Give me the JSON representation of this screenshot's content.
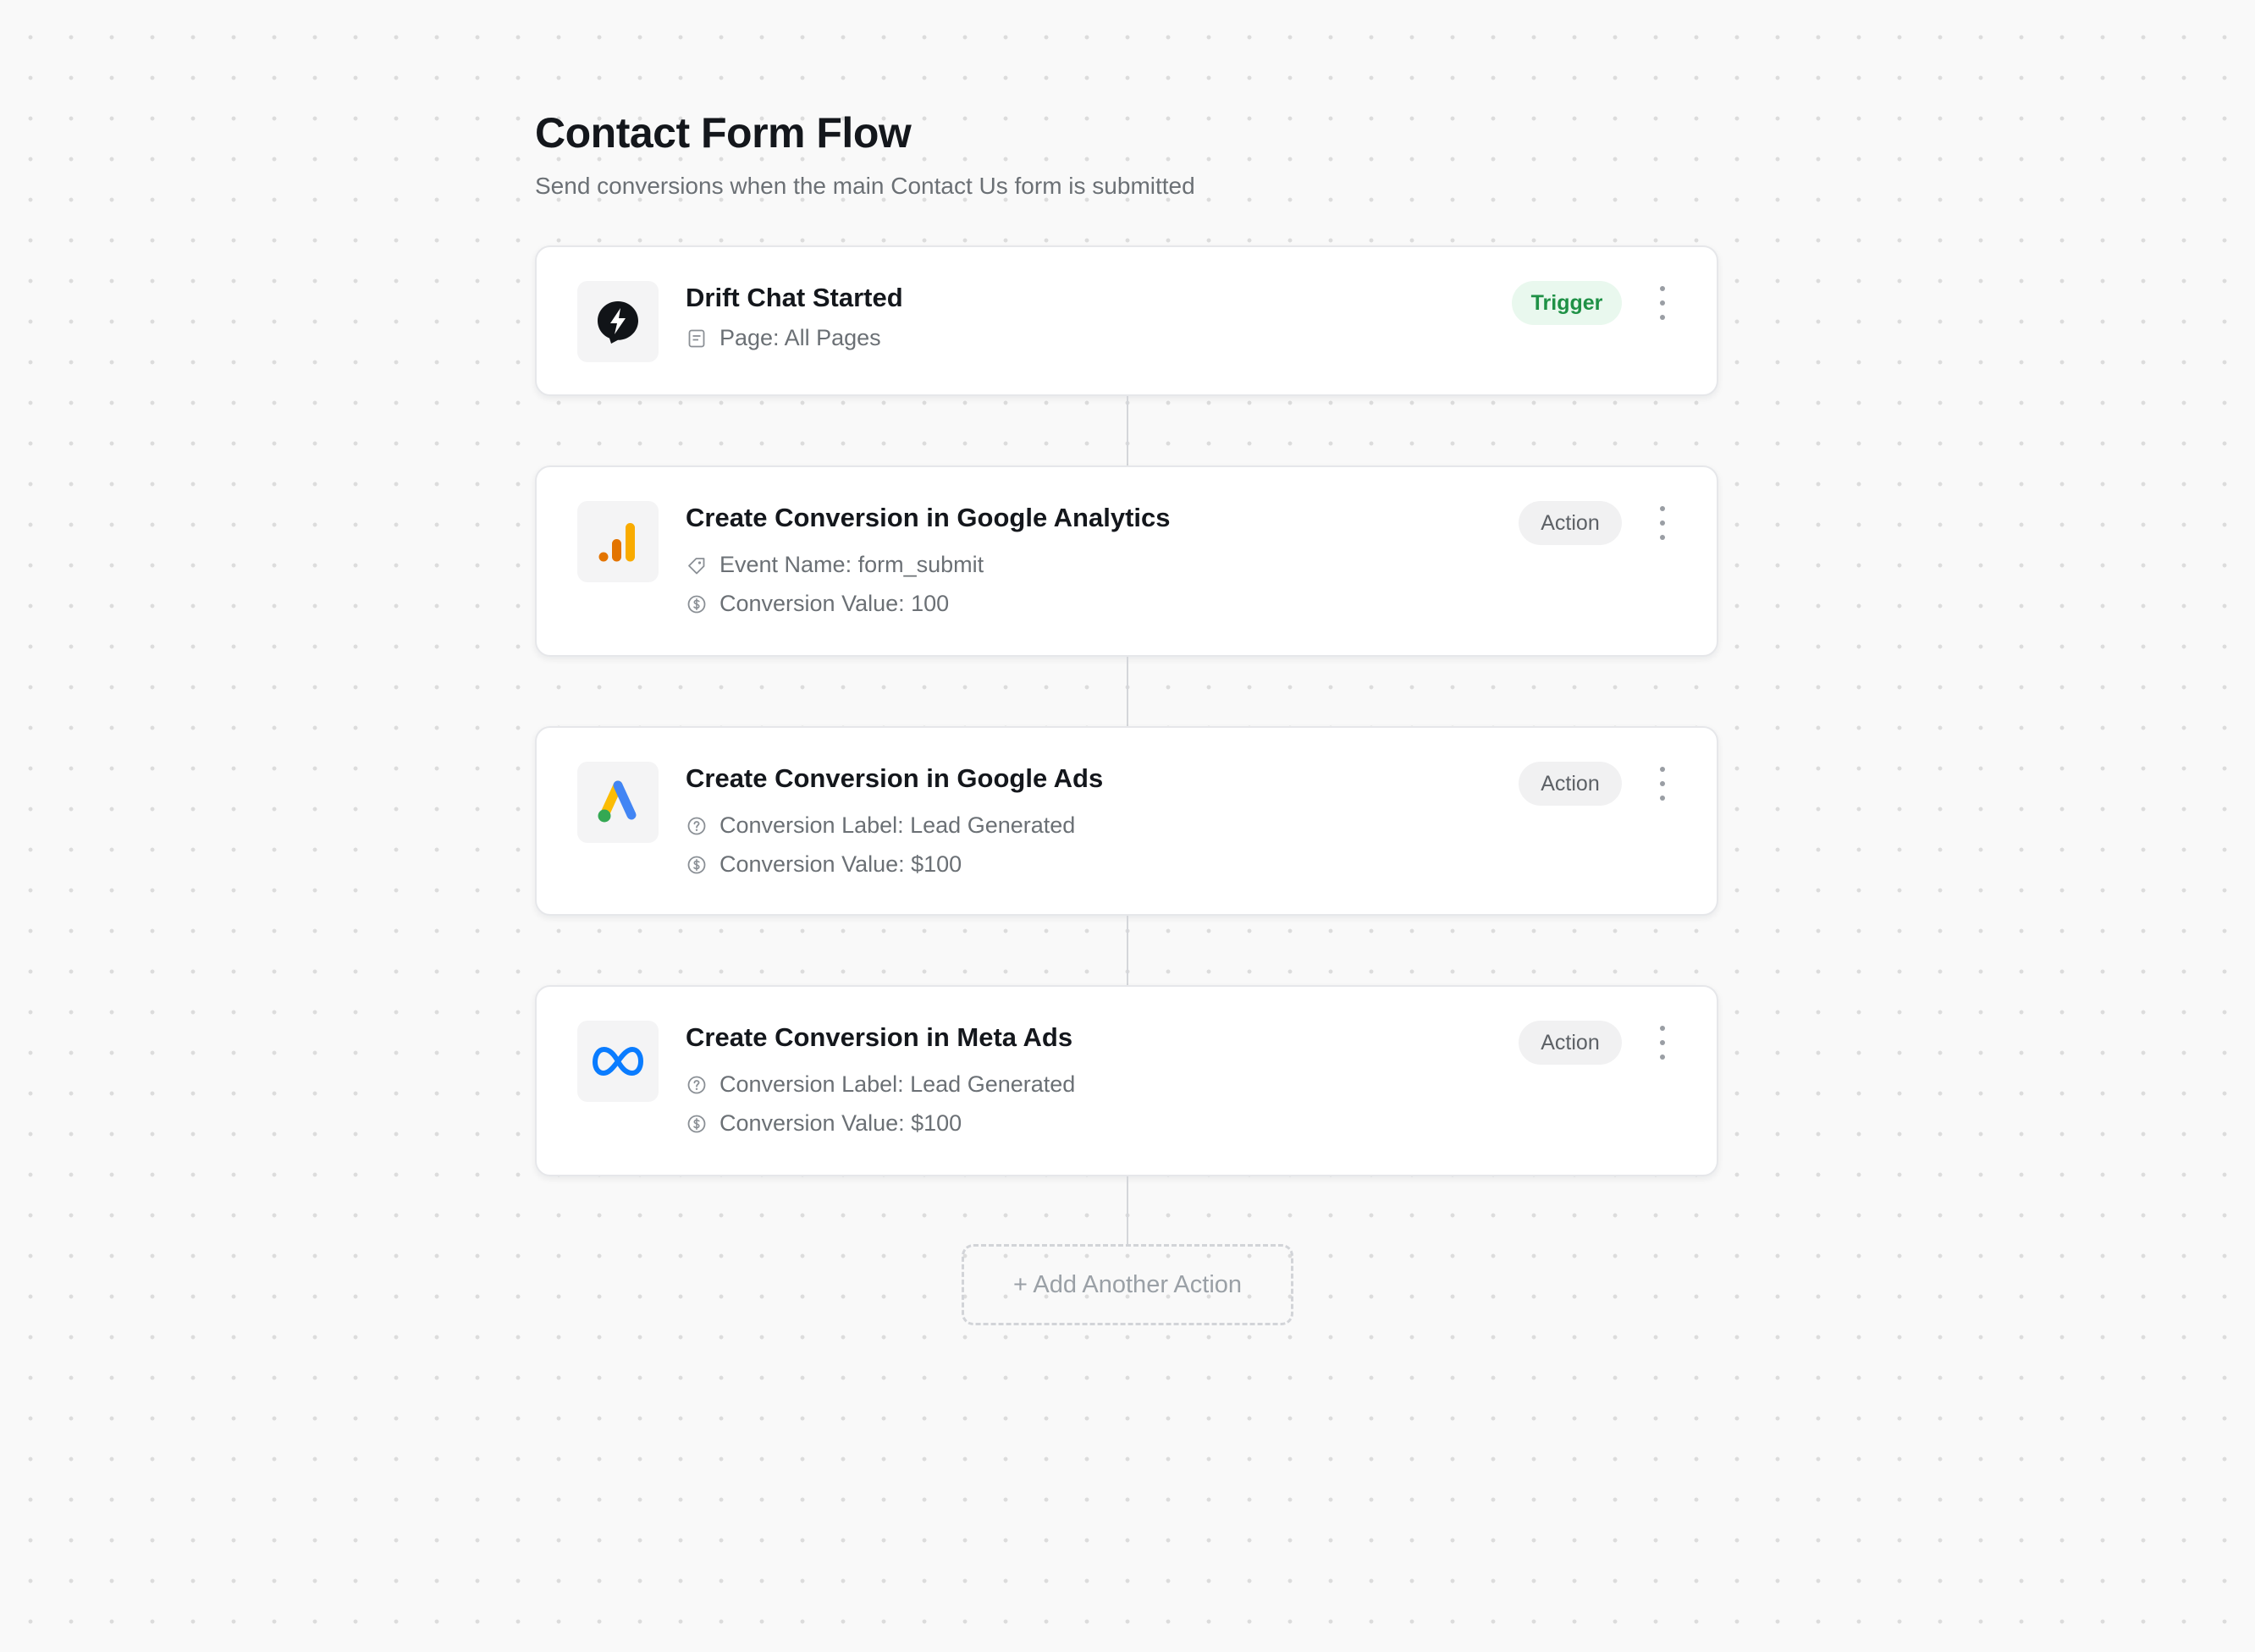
{
  "flow": {
    "title": "Contact Form Flow",
    "subtitle": "Send conversions when the main Contact Us form is submitted"
  },
  "steps": [
    {
      "title": "Drift Chat Started",
      "badge": "Trigger",
      "logo": "drift-logo",
      "meta": [
        {
          "icon": "page-icon",
          "text": "Page: All Pages"
        }
      ]
    },
    {
      "title": "Create Conversion in Google Analytics",
      "badge": "Action",
      "logo": "google-analytics-logo",
      "meta": [
        {
          "icon": "tag-icon",
          "text": "Event Name: form_submit"
        },
        {
          "icon": "dollar-circle-icon",
          "text": "Conversion Value: 100"
        }
      ]
    },
    {
      "title": "Create Conversion in Google Ads",
      "badge": "Action",
      "logo": "google-ads-logo",
      "meta": [
        {
          "icon": "question-circle-icon",
          "text": "Conversion Label: Lead Generated"
        },
        {
          "icon": "dollar-circle-icon",
          "text": "Conversion Value: $100"
        }
      ]
    },
    {
      "title": "Create Conversion in Meta Ads",
      "badge": "Action",
      "logo": "meta-logo",
      "meta": [
        {
          "icon": "question-circle-icon",
          "text": "Conversion Label: Lead Generated"
        },
        {
          "icon": "dollar-circle-icon",
          "text": "Conversion Value: $100"
        }
      ]
    }
  ],
  "add_action_label": "+ Add Another Action",
  "colors": {
    "trigger_badge_bg": "#e9f8ee",
    "trigger_badge_text": "#1f9146",
    "action_badge_bg": "#f1f1f2",
    "ga_orange": "#e37400",
    "ga_yellow": "#f9ab00",
    "ads_blue": "#4285f4",
    "ads_yellow": "#fbbc04",
    "ads_green": "#34a853",
    "meta_blue": "#0a7cff"
  }
}
